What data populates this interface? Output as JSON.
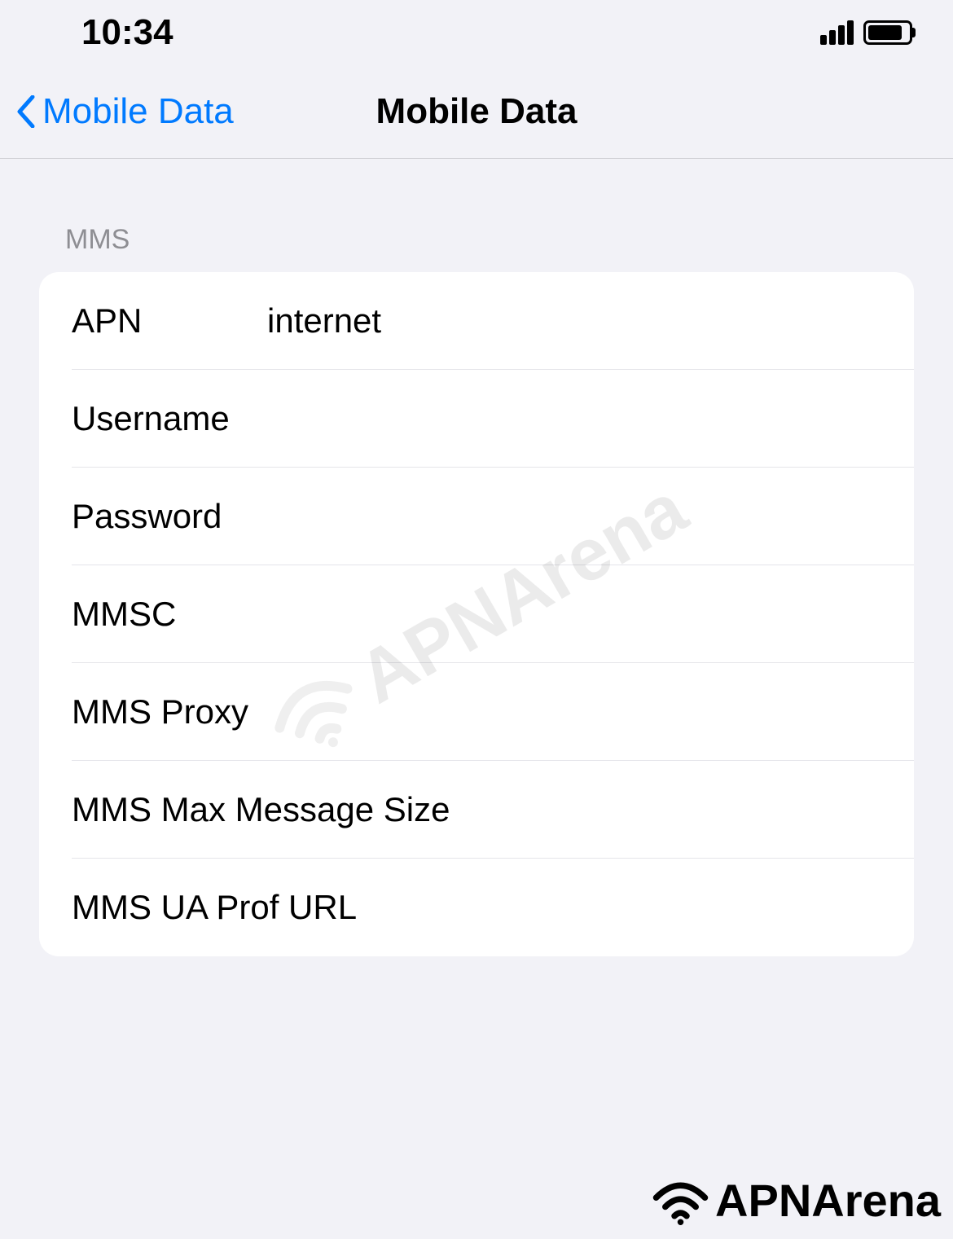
{
  "status": {
    "time": "10:34"
  },
  "nav": {
    "back_label": "Mobile Data",
    "title": "Mobile Data"
  },
  "section": {
    "header": "MMS"
  },
  "fields": {
    "apn": {
      "label": "APN",
      "value": "internet"
    },
    "username": {
      "label": "Username",
      "value": ""
    },
    "password": {
      "label": "Password",
      "value": ""
    },
    "mmsc": {
      "label": "MMSC",
      "value": ""
    },
    "mms_proxy": {
      "label": "MMS Proxy",
      "value": ""
    },
    "mms_max_size": {
      "label": "MMS Max Message Size",
      "value": ""
    },
    "mms_ua_prof": {
      "label": "MMS UA Prof URL",
      "value": ""
    }
  },
  "watermark": {
    "text": "APNArena"
  },
  "footer": {
    "text": "APNArena"
  }
}
